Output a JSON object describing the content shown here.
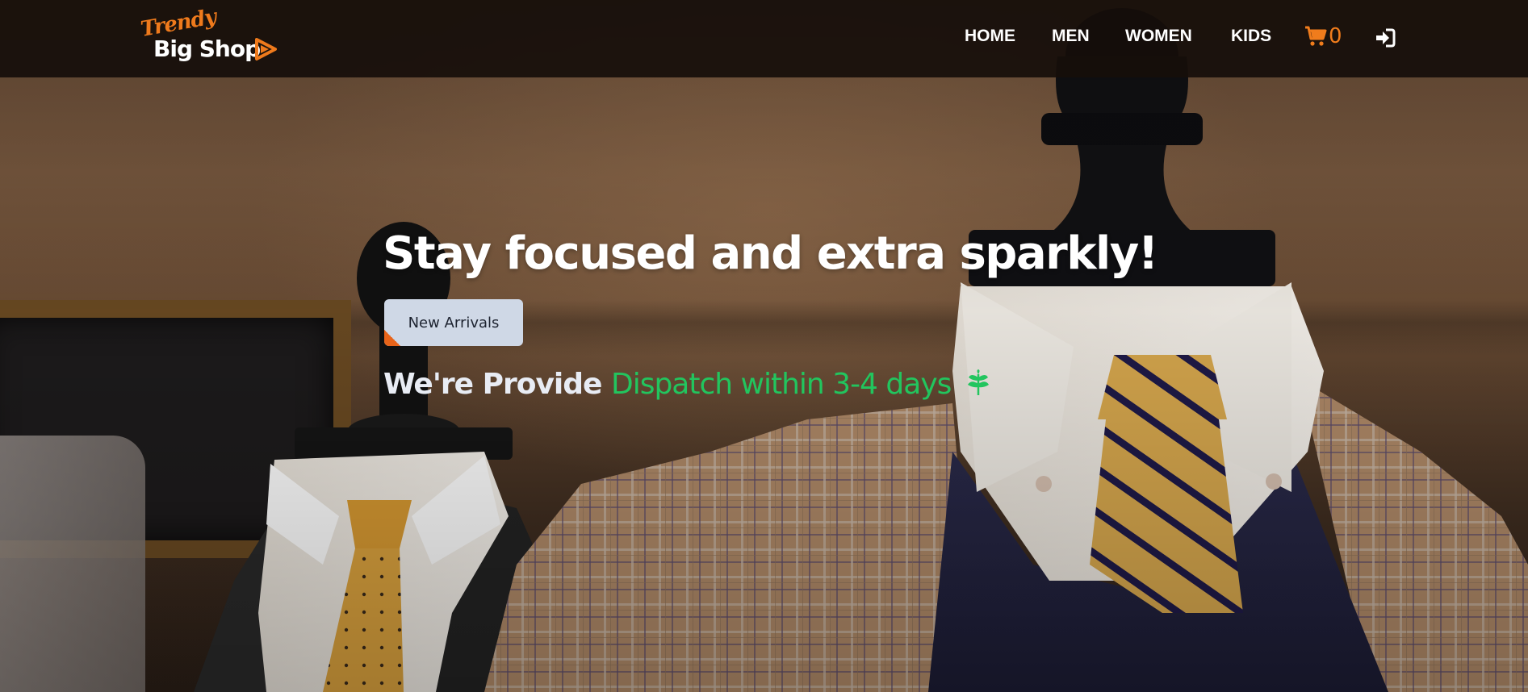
{
  "brand": {
    "script_text": "Trendy",
    "name": "Big Shop",
    "accent_color": "#ef7a1c",
    "icon": "play-triangle-icon"
  },
  "nav": {
    "items": [
      {
        "label": "HOME"
      },
      {
        "label": "MEN"
      },
      {
        "label": "WOMEN"
      },
      {
        "label": "KIDS"
      }
    ],
    "cart": {
      "icon": "cart-icon",
      "count": "0",
      "color": "#f07c1c"
    },
    "login": {
      "icon": "sign-in-icon"
    }
  },
  "hero": {
    "headline": "Stay focused and extra sparkly!",
    "cta_label": "New Arrivals",
    "tagline_lead": "We're Provide ",
    "tagline_highlight": "Dispatch within 3-4 days",
    "highlight_color": "#22c55e",
    "tagline_icon": "leaf-icon",
    "background": "menswear-mannequins-photo"
  }
}
